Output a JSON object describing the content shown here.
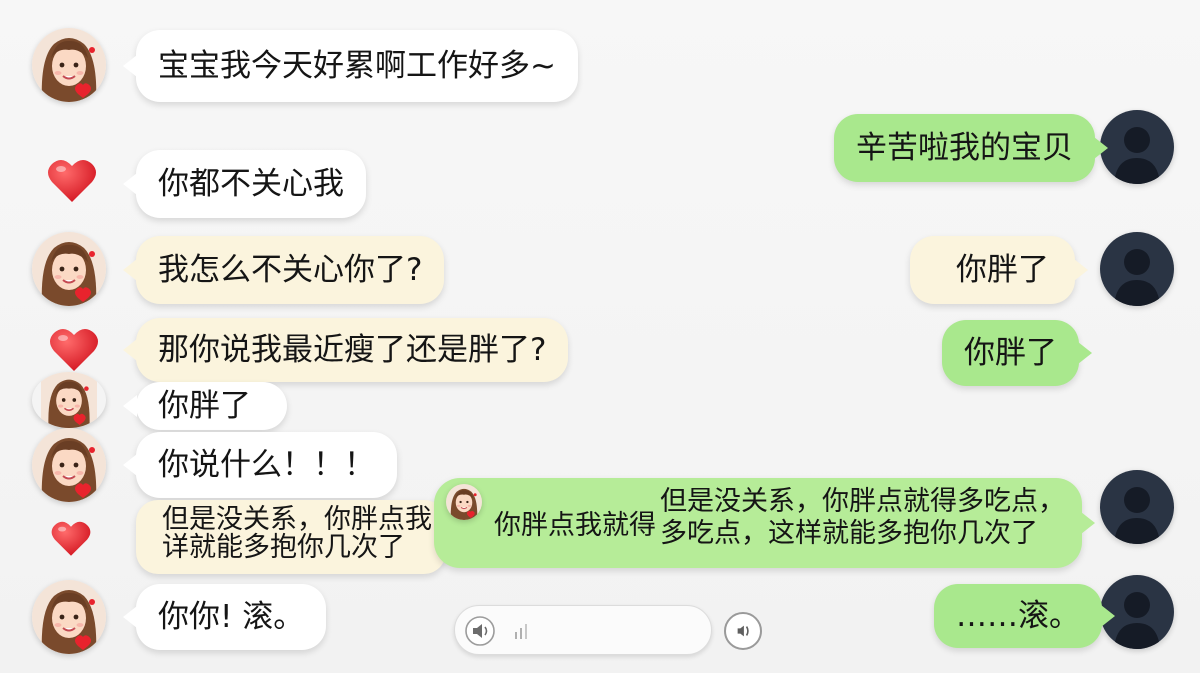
{
  "chat": {
    "messages": [
      {
        "side": "left",
        "text": "宝宝我今天好累啊工作好多~"
      },
      {
        "side": "right",
        "text": "辛苦啦我的宝贝"
      },
      {
        "side": "left",
        "text": "你都不关心我"
      },
      {
        "side": "left",
        "text": "我怎么不关心你了?"
      },
      {
        "side": "right",
        "text": "你胖了"
      },
      {
        "side": "left",
        "text": "那你说我最近瘦了还是胖了?"
      },
      {
        "side": "right",
        "text": "你胖了"
      },
      {
        "side": "left",
        "text": "你胖了"
      },
      {
        "side": "left",
        "text": "你说什么！！！"
      },
      {
        "side": "left",
        "text": "但是没关系，你胖点我，"
      },
      {
        "side": "left",
        "text": "详就能多抱你几次了"
      },
      {
        "side": "right",
        "text": "你胖点我就得"
      },
      {
        "side": "right",
        "text": "但是没关系，你胖点就得多吃点，"
      },
      {
        "side": "right",
        "text": "多吃点，这样就能多抱你几次了"
      },
      {
        "side": "left",
        "text": "你你! 滚。"
      },
      {
        "side": "right",
        "text": "……滚。"
      }
    ]
  },
  "colors": {
    "green_bubble": "#a9e88d",
    "white_bubble": "#ffffff",
    "cream_bubble": "#fbf4dd",
    "heart": "#e8232d",
    "background": "#f4f4f4"
  },
  "icons": {
    "girl_avatar": "girl-avatar-icon",
    "boy_avatar": "silhouette-avatar-icon",
    "heart": "heart-icon",
    "speaker": "speaker-icon",
    "voice_wave": "voice-wave-icon"
  }
}
